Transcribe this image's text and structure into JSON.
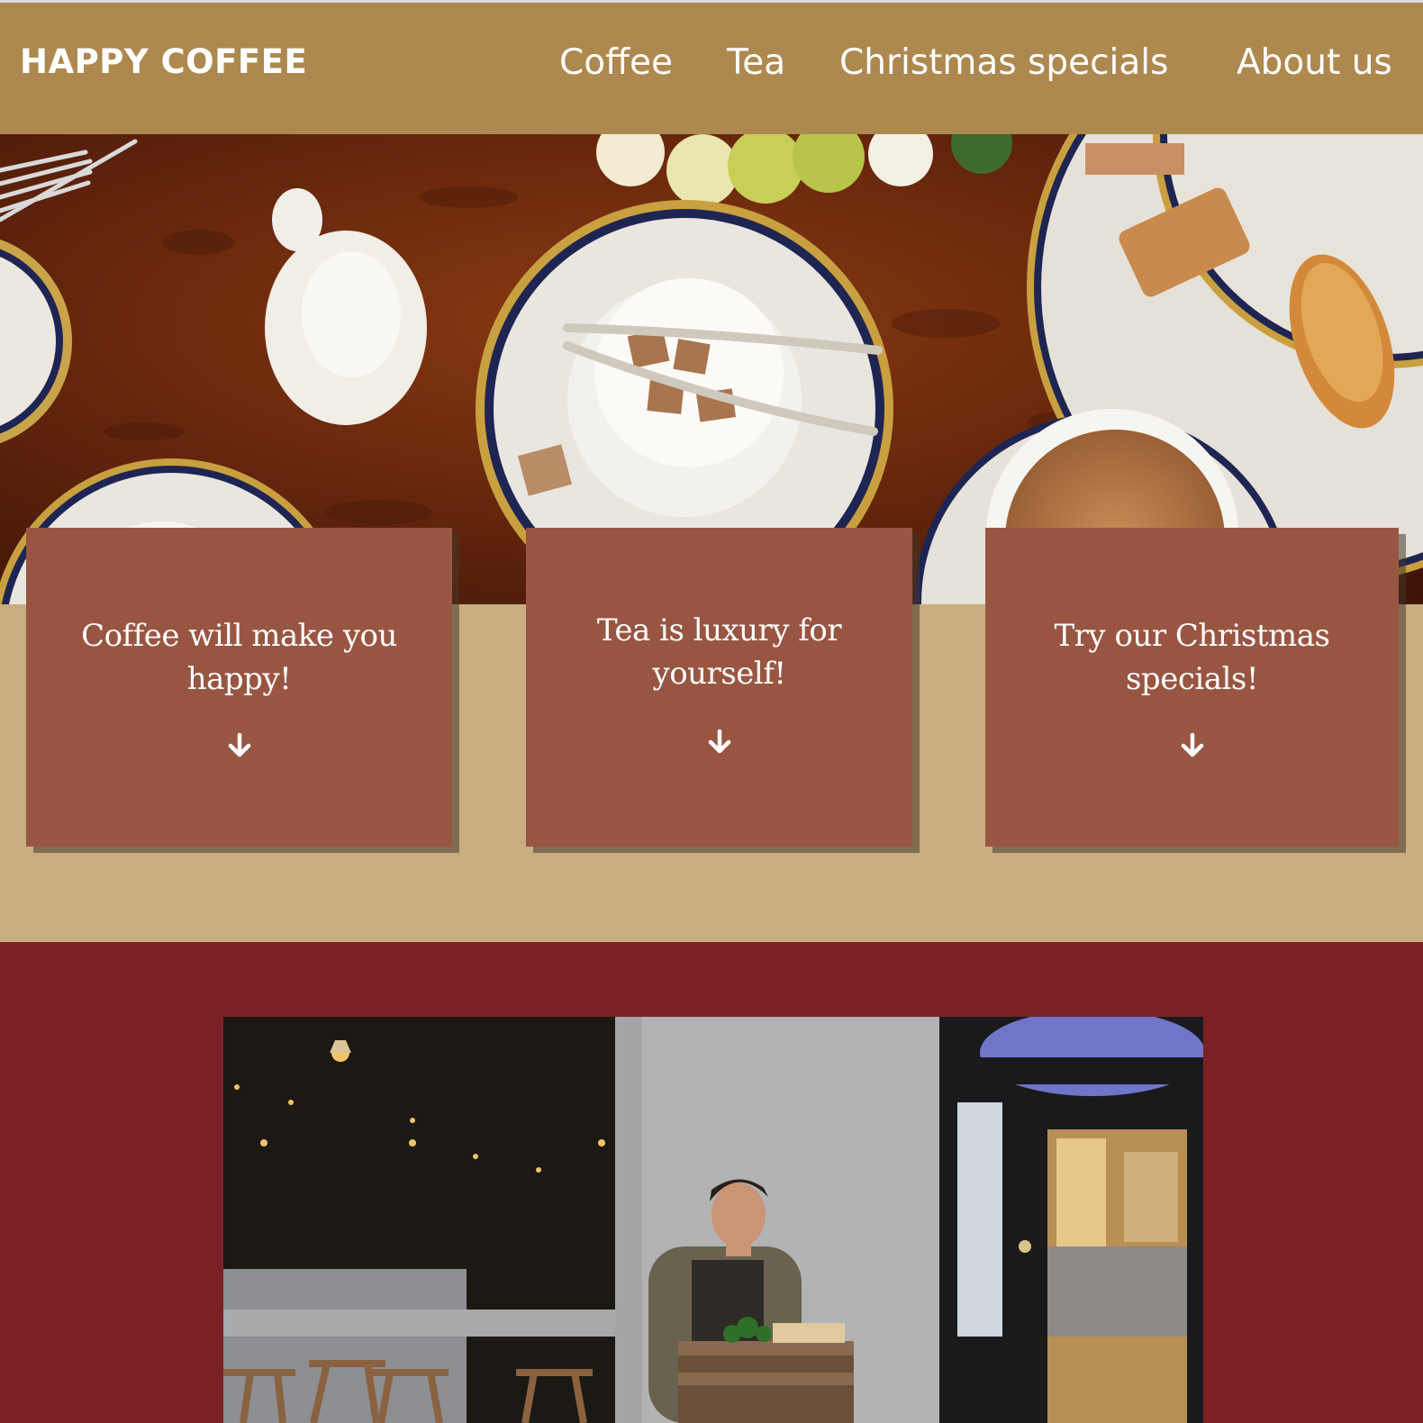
{
  "brand": {
    "name": "HAPPY COFFEE"
  },
  "nav": {
    "items": [
      {
        "label": "Coffee"
      },
      {
        "label": "Tea"
      },
      {
        "label": "Christmas specials"
      },
      {
        "label": "About us"
      }
    ]
  },
  "hero": {
    "image": "tea-table-photo"
  },
  "cards": [
    {
      "text": "Coffee will make you happy!",
      "icon": "arrow-down-icon"
    },
    {
      "text": "Tea is luxury for yourself!",
      "icon": "arrow-down-icon"
    },
    {
      "text": "Try our Christmas specials!",
      "icon": "arrow-down-icon"
    }
  ],
  "about": {
    "image": "barista-storefront-photo"
  },
  "colors": {
    "navbar": "#ad894f",
    "card": "#985642",
    "promo_band": "#c8ad80",
    "about_band": "#7a2125",
    "text": "#ffffff"
  }
}
